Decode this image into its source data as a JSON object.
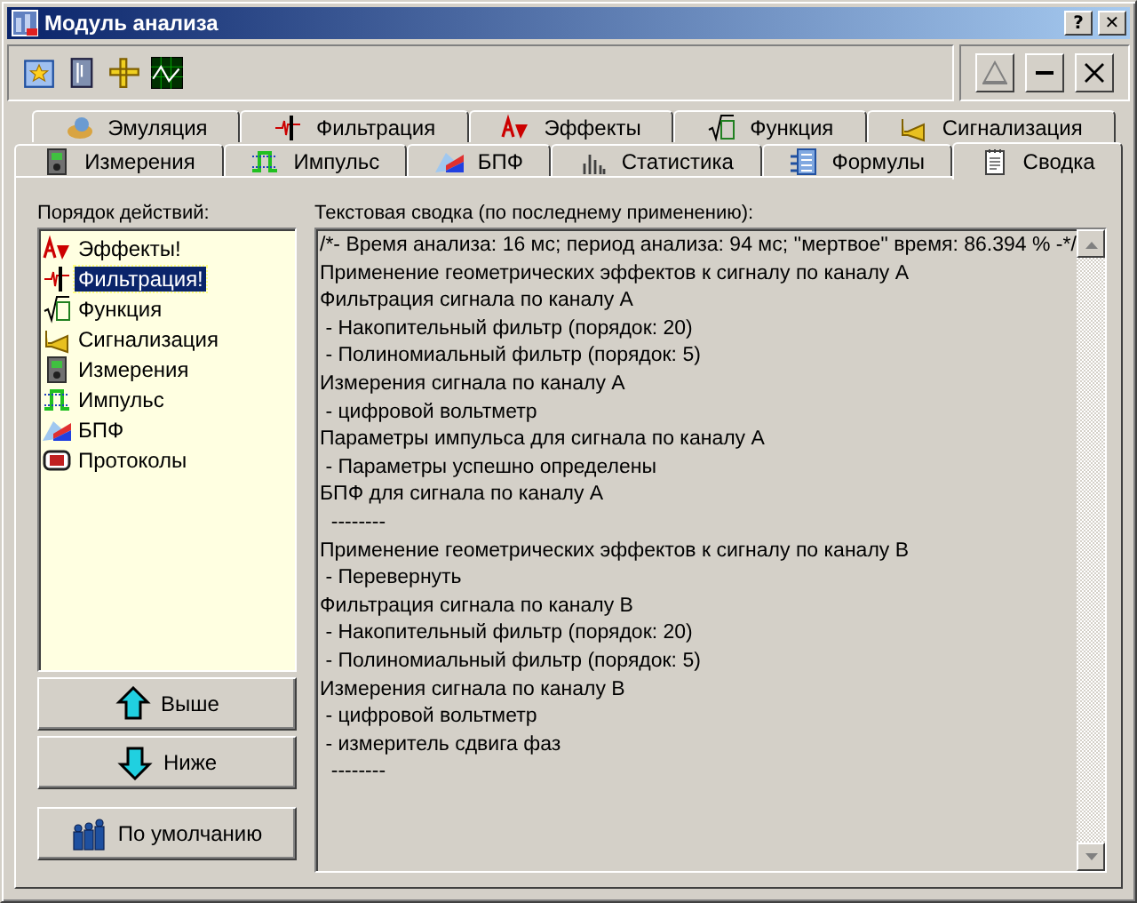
{
  "window": {
    "title": "Модуль анализа",
    "title_buttons": [
      "?",
      "✕"
    ]
  },
  "back_tabs": [
    {
      "label": "Эмуляция",
      "selected": false
    },
    {
      "label": "Фильтрация",
      "selected": false
    },
    {
      "label": "Эффекты",
      "selected": false
    },
    {
      "label": "Функция",
      "selected": false
    },
    {
      "label": "Сигнализация",
      "selected": false
    }
  ],
  "front_tabs": [
    {
      "label": "Измерения",
      "selected": false
    },
    {
      "label": "Импульс",
      "selected": false
    },
    {
      "label": "БПФ",
      "selected": false
    },
    {
      "label": "Статистика",
      "selected": false
    },
    {
      "label": "Формулы",
      "selected": false
    },
    {
      "label": "Сводка",
      "selected": true
    }
  ],
  "actions": {
    "label": "Порядок действий:",
    "items": [
      {
        "label": "Эффекты!",
        "selected": false
      },
      {
        "label": "Фильтрация!",
        "selected": true
      },
      {
        "label": "Функция",
        "selected": false
      },
      {
        "label": "Сигнализация",
        "selected": false
      },
      {
        "label": "Измерения",
        "selected": false
      },
      {
        "label": "Импульс",
        "selected": false
      },
      {
        "label": "БПФ",
        "selected": false
      },
      {
        "label": "Протоколы",
        "selected": false
      }
    ],
    "buttons": [
      {
        "kind": "up",
        "label": "Выше"
      },
      {
        "kind": "down",
        "label": "Ниже"
      },
      {
        "kind": "default",
        "label": "По умолчанию"
      }
    ]
  },
  "summary": {
    "label": "Текстовая сводка (по последнему применению):",
    "lines": [
      "/*- Время анализа: 16 мс; период анализа: 94 мс; ''мертвое'' время: 86.394 % -*/",
      "Применение геометрических эффектов к сигналу по каналу A",
      "Фильтрация сигнала по каналу A",
      " - Накопительный фильтр (порядок: 20)",
      " - Полиномиальный фильтр (порядок: 5)",
      "Измерения сигнала по каналу A",
      " - цифровой вольтметр",
      "Параметры импульса для сигнала по каналу A",
      " - Параметры успешно определены",
      "БПФ для сигнала по каналу A",
      "  --------",
      "Применение геометрических эффектов к сигналу по каналу B",
      " - Перевернуть",
      "Фильтрация сигнала по каналу B",
      " - Накопительный фильтр (порядок: 20)",
      " - Полиномиальный фильтр (порядок: 5)",
      "Измерения сигнала по каналу B",
      " - цифровой вольтметр",
      " - измеритель сдвига фаз",
      "  --------"
    ]
  }
}
